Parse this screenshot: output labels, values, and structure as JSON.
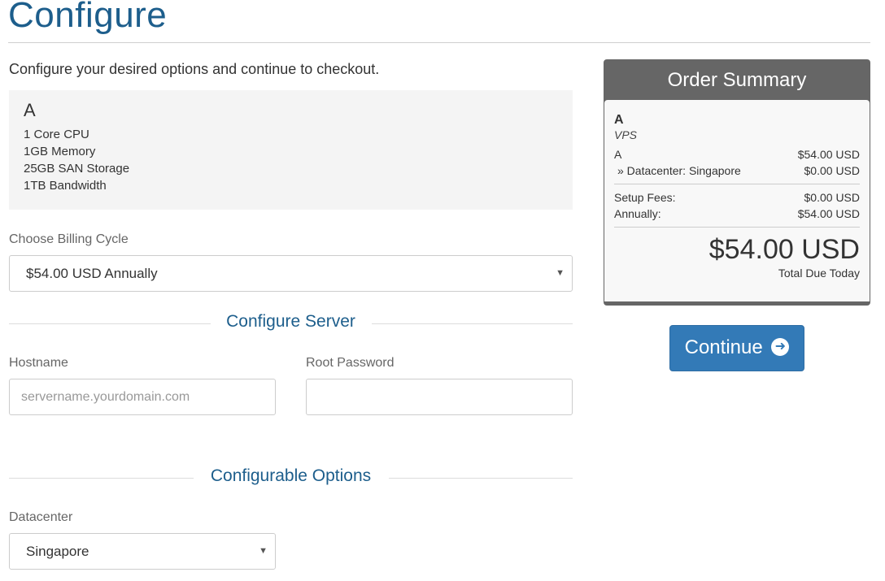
{
  "page": {
    "title": "Configure",
    "intro": "Configure your desired options and continue to checkout."
  },
  "product": {
    "name": "A",
    "features": [
      "1 Core CPU",
      "1GB Memory",
      "25GB SAN Storage",
      "1TB Bandwidth"
    ]
  },
  "billing": {
    "label": "Choose Billing Cycle",
    "selected": "$54.00 USD Annually"
  },
  "server": {
    "heading": "Configure Server",
    "hostname_label": "Hostname",
    "hostname_placeholder": "servername.yourdomain.com",
    "hostname_value": "",
    "password_label": "Root Password",
    "password_value": ""
  },
  "options": {
    "heading": "Configurable Options",
    "datacenter_label": "Datacenter",
    "datacenter_selected": "Singapore"
  },
  "summary": {
    "title": "Order Summary",
    "product_name": "A",
    "product_group": "VPS",
    "lines": [
      {
        "label": "A",
        "amount": "$54.00 USD"
      },
      {
        "label": "» Datacenter: Singapore",
        "amount": "$0.00 USD"
      }
    ],
    "fees": [
      {
        "label": "Setup Fees:",
        "amount": "$0.00 USD"
      },
      {
        "label": "Annually:",
        "amount": "$54.00 USD"
      }
    ],
    "total": "$54.00 USD",
    "total_label": "Total Due Today"
  },
  "actions": {
    "continue_label": "Continue",
    "continue_icon": "arrow-circle-right-icon"
  },
  "colors": {
    "heading_blue": "#1d5e8c",
    "button_blue": "#337ab7",
    "summary_header": "#666666"
  }
}
